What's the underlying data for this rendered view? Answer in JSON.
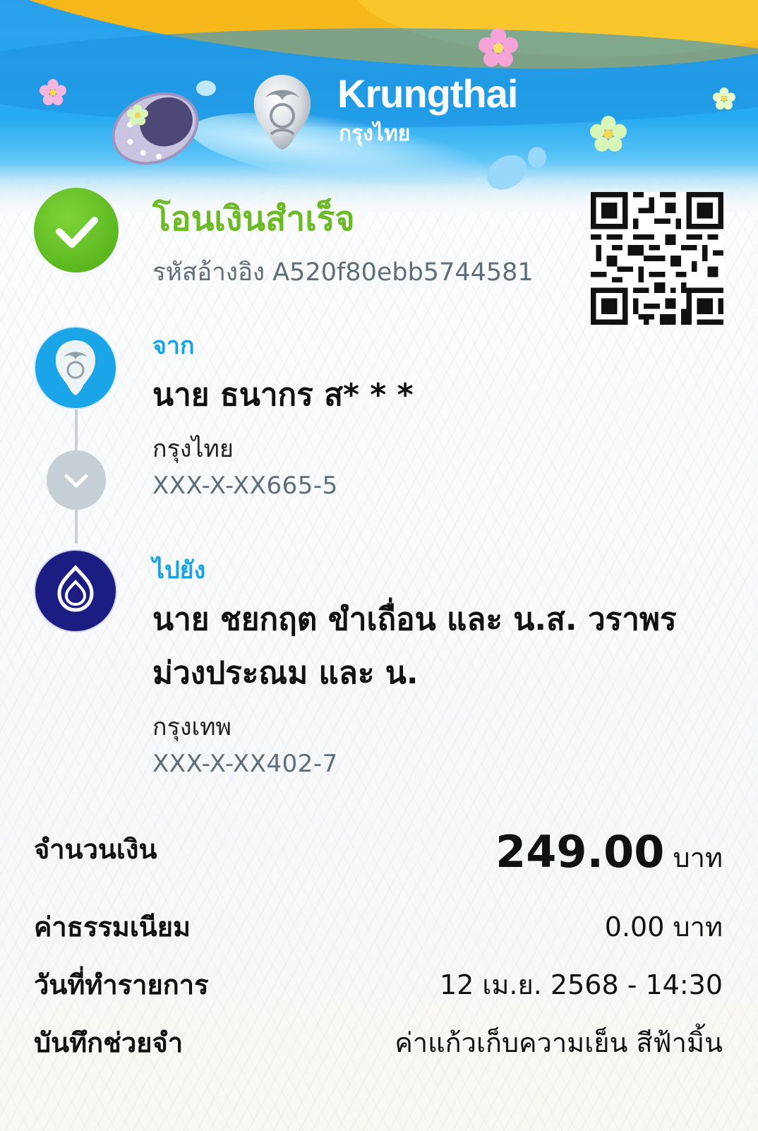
{
  "header": {
    "brand_en": "Krungthai",
    "brand_th": "กรุงไทย",
    "colors": {
      "sky": "#26aaf0",
      "sun": "#f7b81c",
      "flower": "#f5a3d8"
    }
  },
  "status": {
    "title": "โอนเงินสำเร็จ",
    "reference": "รหัสอ้างอิง A520f80ebb5744581",
    "icon": "check-icon",
    "color": "#6cba26"
  },
  "from": {
    "label": "จาก",
    "name": "นาย ธนากร ส* * *",
    "bank": "กรุงไทย",
    "account": "XXX-X-XX665-5",
    "icon": "krungthai-bank-icon"
  },
  "to": {
    "label": "ไปยัง",
    "name_line1": "นาย ชยกฤต ขำเถื่อน และ น.ส. วราพร",
    "name_line2": "ม่วงประณม และ น.",
    "bank": "กรุงเทพ",
    "account": "XXX-X-XX402-7",
    "icon": "bangkok-bank-icon"
  },
  "details": {
    "amount_label": "จำนวนเงิน",
    "amount": "249.00",
    "amount_unit": "บาท",
    "fee_label": "ค่าธรรมเนียม",
    "fee": "0.00 บาท",
    "date_label": "วันที่ทำรายการ",
    "date": "12 เม.ย. 2568 - 14:30",
    "memo_label": "บันทึกช่วยจำ",
    "memo": "ค่าแก้วเก็บความเย็น สีฟ้ามิ้น"
  }
}
